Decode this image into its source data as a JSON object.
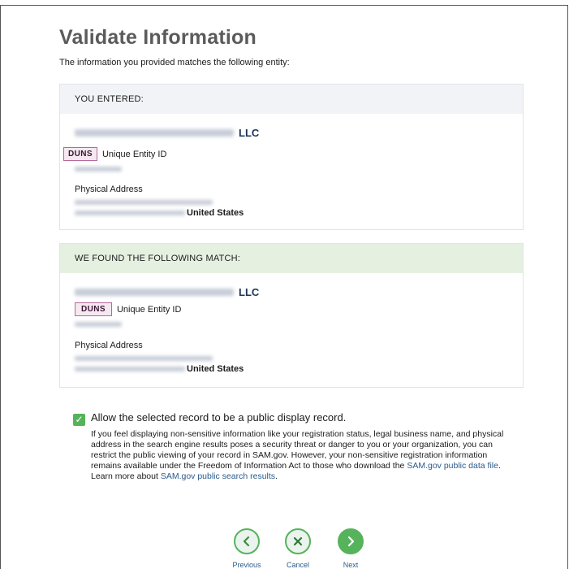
{
  "page": {
    "title": "Validate Information",
    "intro": "The information you provided matches the following entity:"
  },
  "entered": {
    "heading": "YOU ENTERED:",
    "entity_suffix": "LLC",
    "id_badge": "DUNS",
    "id_label": "Unique Entity ID",
    "address_label": "Physical Address",
    "country": "United States"
  },
  "found": {
    "heading": "WE FOUND THE FOLLOWING MATCH:",
    "entity_suffix": "LLC",
    "id_badge": "DUNS",
    "id_label": "Unique Entity ID",
    "address_label": "Physical Address",
    "country": "United States"
  },
  "consent": {
    "checked": true,
    "label": "Allow the selected record to be a public display record.",
    "body_1": "If you feel displaying non-sensitive information like your registration status, legal business name, and physical address in the search engine results poses a security threat or danger to you or your organization, you can restrict the public viewing of your record in SAM.gov. However, your non-sensitive registration information remains available under the Freedom of Information Act to those who download the ",
    "link_data_file": "SAM.gov public data file",
    "body_2": ". Learn more about ",
    "link_search": "SAM.gov public search results",
    "body_3": "."
  },
  "nav": {
    "previous": "Previous",
    "cancel": "Cancel",
    "next": "Next"
  },
  "colors": {
    "accent_green": "#56b35b",
    "link_blue": "#2a5b8c",
    "entered_header_bg": "#f1f3f6",
    "found_header_bg": "#e6f0e1",
    "duns_badge_border": "#b5679e"
  },
  "icons": {
    "previous": "chevron-left-icon",
    "cancel": "close-icon",
    "next": "chevron-right-icon",
    "checkbox": "checkmark-icon"
  }
}
